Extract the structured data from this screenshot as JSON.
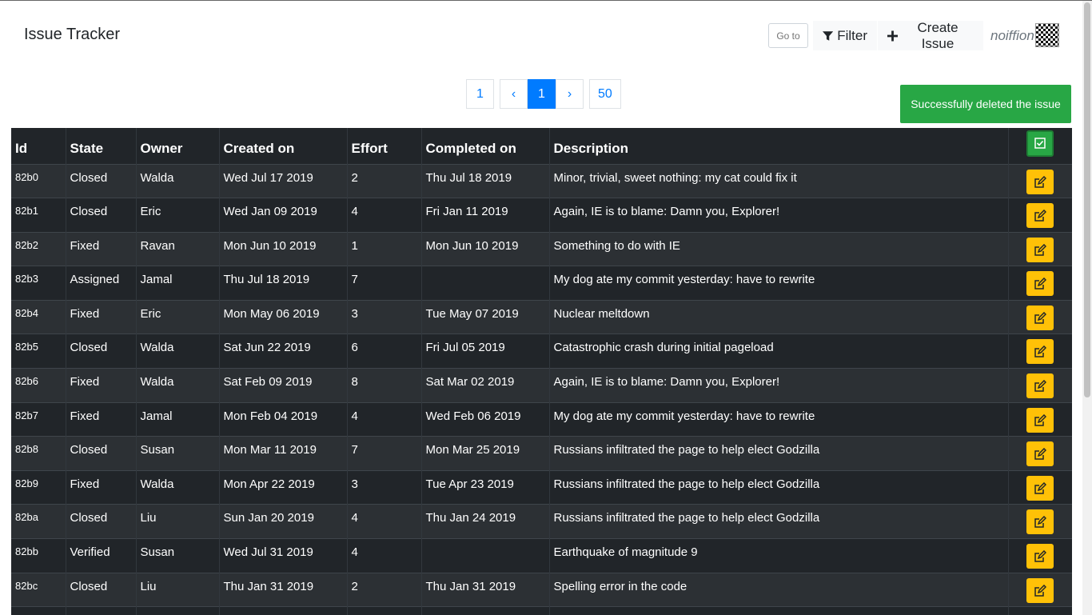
{
  "header": {
    "title": "Issue Tracker",
    "goto_placeholder": "Go to",
    "filter_label": "Filter",
    "create_label": "Create Issue",
    "username": "noiffion"
  },
  "pagination": {
    "first": "1",
    "prev": "‹",
    "current": "1",
    "next": "›",
    "last": "50"
  },
  "toast": {
    "message": "Successfully deleted the issue",
    "color": "#28a745"
  },
  "table": {
    "columns": [
      "Id",
      "State",
      "Owner",
      "Created on",
      "Effort",
      "Completed on",
      "Description"
    ],
    "rows": [
      {
        "id": "82b0",
        "state": "Closed",
        "owner": "Walda",
        "created": "Wed Jul 17 2019",
        "effort": "2",
        "completed": "Thu Jul 18 2019",
        "description": "Minor, trivial, sweet nothing: my cat could fix it"
      },
      {
        "id": "82b1",
        "state": "Closed",
        "owner": "Eric",
        "created": "Wed Jan 09 2019",
        "effort": "4",
        "completed": "Fri Jan 11 2019",
        "description": "Again, IE is to blame: Damn you, Explorer!"
      },
      {
        "id": "82b2",
        "state": "Fixed",
        "owner": "Ravan",
        "created": "Mon Jun 10 2019",
        "effort": "1",
        "completed": "Mon Jun 10 2019",
        "description": "Something to do with IE"
      },
      {
        "id": "82b3",
        "state": "Assigned",
        "owner": "Jamal",
        "created": "Thu Jul 18 2019",
        "effort": "7",
        "completed": "",
        "description": "My dog ate my commit yesterday: have to rewrite"
      },
      {
        "id": "82b4",
        "state": "Fixed",
        "owner": "Eric",
        "created": "Mon May 06 2019",
        "effort": "3",
        "completed": "Tue May 07 2019",
        "description": "Nuclear meltdown"
      },
      {
        "id": "82b5",
        "state": "Closed",
        "owner": "Walda",
        "created": "Sat Jun 22 2019",
        "effort": "6",
        "completed": "Fri Jul 05 2019",
        "description": "Catastrophic crash during initial pageload"
      },
      {
        "id": "82b6",
        "state": "Fixed",
        "owner": "Walda",
        "created": "Sat Feb 09 2019",
        "effort": "8",
        "completed": "Sat Mar 02 2019",
        "description": "Again, IE is to blame: Damn you, Explorer!"
      },
      {
        "id": "82b7",
        "state": "Fixed",
        "owner": "Jamal",
        "created": "Mon Feb 04 2019",
        "effort": "4",
        "completed": "Wed Feb 06 2019",
        "description": "My dog ate my commit yesterday: have to rewrite"
      },
      {
        "id": "82b8",
        "state": "Closed",
        "owner": "Susan",
        "created": "Mon Mar 11 2019",
        "effort": "7",
        "completed": "Mon Mar 25 2019",
        "description": "Russians infiltrated the page to help elect Godzilla"
      },
      {
        "id": "82b9",
        "state": "Fixed",
        "owner": "Walda",
        "created": "Mon Apr 22 2019",
        "effort": "3",
        "completed": "Tue Apr 23 2019",
        "description": "Russians infiltrated the page to help elect Godzilla"
      },
      {
        "id": "82ba",
        "state": "Closed",
        "owner": "Liu",
        "created": "Sun Jan 20 2019",
        "effort": "4",
        "completed": "Thu Jan 24 2019",
        "description": "Russians infiltrated the page to help elect Godzilla"
      },
      {
        "id": "82bb",
        "state": "Verified",
        "owner": "Susan",
        "created": "Wed Jul 31 2019",
        "effort": "4",
        "completed": "",
        "description": "Earthquake of magnitude 9"
      },
      {
        "id": "82bc",
        "state": "Closed",
        "owner": "Liu",
        "created": "Thu Jan 31 2019",
        "effort": "2",
        "completed": "Thu Jan 31 2019",
        "description": "Spelling error in the code"
      }
    ]
  }
}
